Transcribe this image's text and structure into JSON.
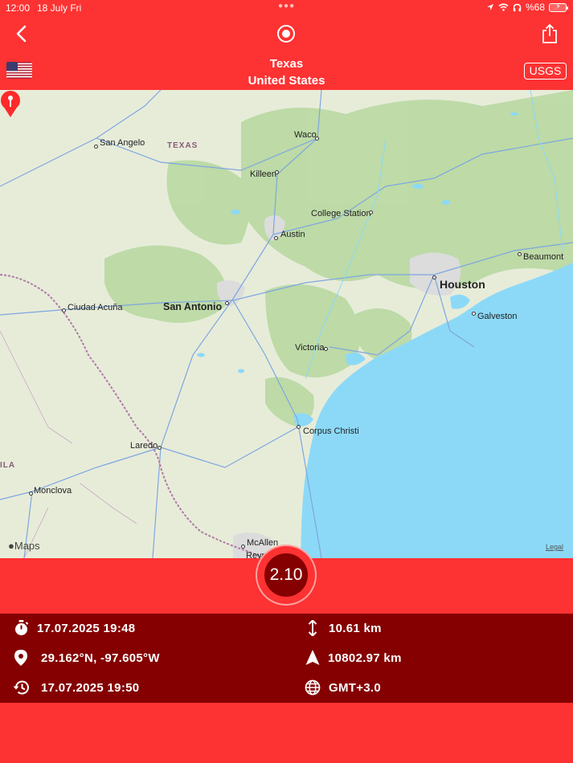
{
  "status_bar": {
    "time": "12:00",
    "date": "18 July Fri",
    "battery": "%68"
  },
  "nav": {
    "back_icon": "chevron-left-icon",
    "center_icon": "record-icon",
    "share_icon": "share-icon"
  },
  "location": {
    "region": "Texas",
    "country": "United States",
    "source": "USGS",
    "flag_icon": "us-flag-icon"
  },
  "map": {
    "labels": {
      "state": "TEXAS",
      "san_angelo": "San Angelo",
      "waco": "Waco",
      "killeen": "Killeen",
      "college_station": "College Station",
      "austin": "Austin",
      "beaumont": "Beaumont",
      "houston": "Houston",
      "ciudad_acuna": "Ciudad Acuña",
      "san_antonio": "San Antonio",
      "galveston": "Galveston",
      "victoria": "Victoria",
      "corpus_christi": "Corpus Christi",
      "laredo": "Laredo",
      "ila": "ILA",
      "monclova": "Monclova",
      "mcallen": "McAllen",
      "reynosa": "Reynosa"
    },
    "brand": "Maps",
    "legal": "Legal"
  },
  "earthquake": {
    "magnitude": "2.10",
    "time": "17.07.2025 19:48",
    "coordinates": "29.162°N, -97.605°W",
    "updated": "17.07.2025 19:50",
    "depth": "10.61 km",
    "distance": "10802.97 km",
    "timezone": "GMT+3.0"
  },
  "colors": {
    "accent": "#fd3232",
    "dark": "#850000",
    "water": "#8cd9f7",
    "land": "#e7ecd9",
    "forest": "#b9d9a2"
  }
}
